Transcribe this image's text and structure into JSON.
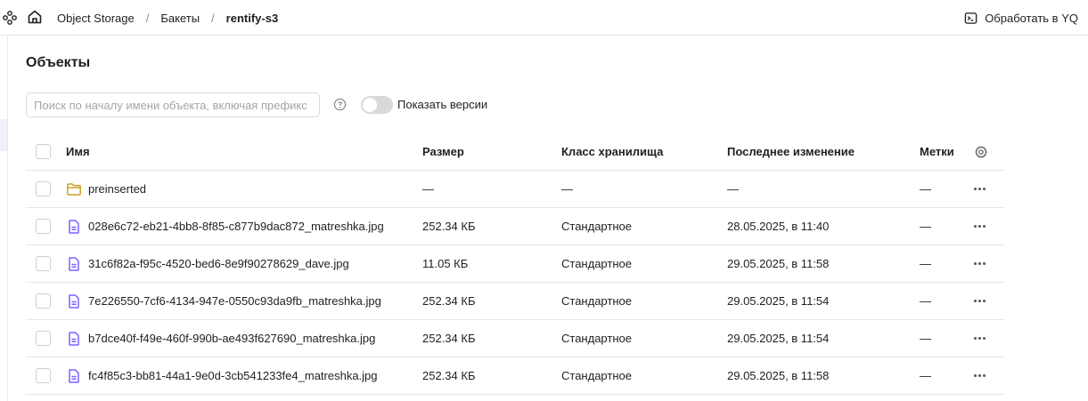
{
  "header": {
    "breadcrumbs": [
      "Object Storage",
      "Бакеты",
      "rentify-s3"
    ],
    "separator": "/",
    "yq_button": "Обработать в YQ"
  },
  "page": {
    "title": "Объекты",
    "search_placeholder": "Поиск по началу имени объекта, включая префикс",
    "show_versions_label": "Показать версии",
    "show_versions_on": false
  },
  "table": {
    "columns": {
      "name": "Имя",
      "size": "Размер",
      "storage_class": "Класс хранилища",
      "modified": "Последнее изменение",
      "tags": "Метки"
    },
    "rows": [
      {
        "type": "folder",
        "name": "preinserted",
        "size": "—",
        "storage_class": "—",
        "modified": "—",
        "tags": "—"
      },
      {
        "type": "file",
        "name": "028e6c72-eb21-4bb8-8f85-c877b9dac872_matreshka.jpg",
        "size": "252.34 КБ",
        "storage_class": "Стандартное",
        "modified": "28.05.2025, в 11:40",
        "tags": "—"
      },
      {
        "type": "file",
        "name": "31c6f82a-f95c-4520-bed6-8e9f90278629_dave.jpg",
        "size": "11.05 КБ",
        "storage_class": "Стандартное",
        "modified": "29.05.2025, в 11:58",
        "tags": "—"
      },
      {
        "type": "file",
        "name": "7e226550-7cf6-4134-947e-0550c93da9fb_matreshka.jpg",
        "size": "252.34 КБ",
        "storage_class": "Стандартное",
        "modified": "29.05.2025, в 11:54",
        "tags": "—"
      },
      {
        "type": "file",
        "name": "b7dce40f-f49e-460f-990b-ae493f627690_matreshka.jpg",
        "size": "252.34 КБ",
        "storage_class": "Стандартное",
        "modified": "29.05.2025, в 11:54",
        "tags": "—"
      },
      {
        "type": "file",
        "name": "fc4f85c3-bb81-44a1-9e0d-3cb541233fe4_matreshka.jpg",
        "size": "252.34 КБ",
        "storage_class": "Стандартное",
        "modified": "29.05.2025, в 11:58",
        "tags": "—"
      }
    ]
  },
  "colors": {
    "folder_icon": "#c9a227",
    "file_icon": "#7b61ff",
    "border": "#e6e6e6",
    "toggle_off": "#d9d9d9"
  },
  "icons": {
    "services": "services-icon",
    "home": "home-icon",
    "terminal": "terminal-icon",
    "help": "help-icon",
    "settings": "gear-icon",
    "folder": "folder-icon",
    "file": "file-icon",
    "more": "more-icon"
  }
}
